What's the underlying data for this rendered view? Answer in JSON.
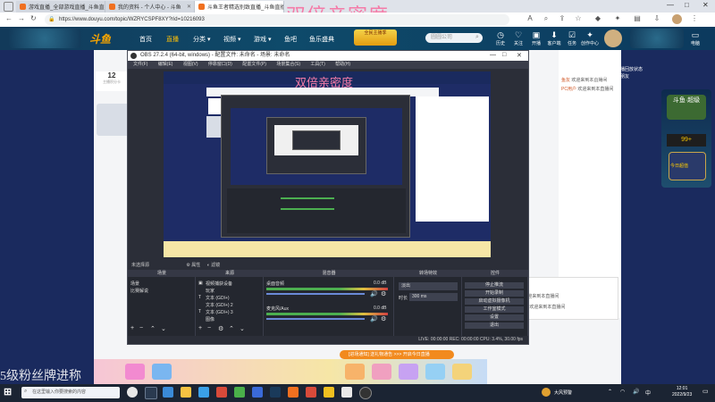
{
  "browser": {
    "tabs": [
      {
        "label": "游戏直播_全部游戏直播_斗鱼直播"
      },
      {
        "label": "我的资料 - 个人中心 - 斗鱼"
      },
      {
        "label": "斗鱼王者精选别致直播_斗鱼直播"
      }
    ],
    "url": "https://www.douyu.com/topic/WZRYCSPF8XY?rid=10216093"
  },
  "overlay_title": "双倍亲密度",
  "site": {
    "logo": "斗鱼",
    "nav": [
      {
        "label": "首页"
      },
      {
        "label": "直播"
      },
      {
        "label": "分类 ▾"
      },
      {
        "label": "视频 ▾"
      },
      {
        "label": "游戏 ▾"
      },
      {
        "label": "鱼吧"
      },
      {
        "label": "鱼乐盛典"
      }
    ],
    "promo": "全民主播季",
    "search_placeholder": "圆圆公司",
    "header_icons": [
      {
        "label": "历史"
      },
      {
        "label": "关注"
      },
      {
        "label": "开播"
      },
      {
        "label": "客户端"
      },
      {
        "label": "任务"
      },
      {
        "label": "创作中心"
      },
      {
        "label": "电脑"
      }
    ],
    "room_count": "12",
    "room_label": "主播积分卡"
  },
  "obs": {
    "title": "OBS 27.2.4 (64-bit, windows) - 配置文件: 未命名 - 场景: 未命名",
    "menu": [
      "文件(F)",
      "编辑(E)",
      "视图(V)",
      "停靠窗口(D)",
      "配置文件(P)",
      "场景集合(S)",
      "工具(T)",
      "帮助(H)"
    ],
    "status_line": "未选择源",
    "properties_label": "属性",
    "filters_label": "滤镜",
    "docks": {
      "scenes": "场景",
      "sources": "来源",
      "mixer": "混音器",
      "transitions": "转场特效",
      "controls": "控件"
    },
    "scenes": [
      "场景",
      "比赛解说"
    ],
    "sources": [
      "视频捕获设备",
      "玩家",
      "文本 (GDI+)",
      "文本 (GDI+) 2",
      "文本 (GDI+) 3",
      "图像"
    ],
    "mixer_tracks": [
      {
        "name": "桌面音频",
        "level": "0.0 dB"
      },
      {
        "name": "麦克风/Aux",
        "level": "0.0 dB"
      }
    ],
    "transition": {
      "type": "淡出",
      "duration_label": "时长",
      "duration": "300 ms"
    },
    "controls": [
      "停止推流",
      "开始录制",
      "启动虚拟摄像机",
      "工作室模式",
      "设置",
      "退出"
    ],
    "statusbar": "LIVE: 00:00:00   REC: 00:00:00   CPU: 3.4%, 30.00 fps"
  },
  "page_side": {
    "left_banner": "5级粉丝牌进称",
    "right_badges": [
      "斗鱼·超级",
      "99+",
      "今日超值"
    ],
    "right_lines": [
      "欢迎观赏斗鱼精英",
      "已开通欢迎观赏直播回放状态",
      "欢迎主播您的各位朋友",
      "前往斗鱼直播"
    ],
    "chat": [
      {
        "user": "鱼友",
        "text": "欢迎来到本直播间"
      },
      {
        "user": "PC用户",
        "text": "欢迎来到本直播间"
      }
    ],
    "live_banner": "[进场通知] 送礼物通告 >>> 开启今日直播"
  },
  "taskbar": {
    "search_placeholder": "在这里输入你要搜索的内容",
    "weather": "大风预警",
    "time": "12:01",
    "date": "2022/9/23"
  },
  "colors": {
    "accent": "#f6a400",
    "overlay_pink": "#f47ba8",
    "site_header": "#0e4a6a",
    "obs_bg": "#2b2e38"
  }
}
